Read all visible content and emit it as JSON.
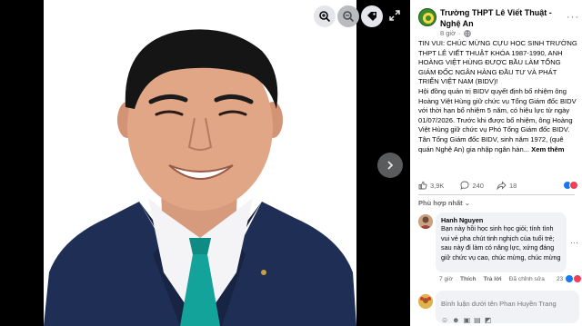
{
  "viewer": {
    "tools": {
      "zoom_in_icon": "zoom-in-icon",
      "zoom_out_icon": "zoom-out-icon",
      "tag_icon": "tag-icon",
      "fullscreen_icon": "expand-icon"
    },
    "next_icon": "chevron-right-icon"
  },
  "post": {
    "page_name": "Trường THPT Lê Viết Thuật - Nghệ An",
    "time": "8 giờ",
    "paragraphs": [
      "TIN VUI: CHÚC MỪNG CỰU HỌC SINH TRƯỜNG THPT LÊ VIẾT THUẬT KHÓA 1987-1990, ANH HOÀNG VIỆT HÙNG ĐƯỢC BẦU LÀM TỔNG GIÁM ĐỐC NGÂN HÀNG ĐẦU TƯ VÀ PHÁT TRIỂN VIỆT NAM (BIDV)!",
      "Hội đồng quản trị BIDV quyết định bổ nhiệm ông Hoàng Việt Hùng giữ chức vụ Tổng Giám đốc BIDV với thời hạn bổ nhiệm 5 năm, có hiệu lực từ ngày 01/07/2026. Trước khi được bổ nhiệm, ông Hoàng Việt Hùng giữ chức vụ Phó Tổng Giám đốc BIDV.",
      "Tân Tổng Giám đốc BIDV, sinh năm 1972, (quê quán Nghệ An) gia nhập ngân hàn..."
    ],
    "see_more": "Xem thêm",
    "stats": {
      "likes": "3,9K",
      "comments": "240",
      "shares": "18"
    }
  },
  "comments": {
    "filter_label": "Phù hợp nhất",
    "items": [
      {
        "author": "Hanh Nguyen",
        "text": "Bạn này hồi học sinh học giỏi; tính tình vui vẻ pha chút tinh nghịch của tuổi trẻ; sau này đi làm có năng lực, xứng đáng giữ chức vụ cao, chúc mừng, chúc mừng",
        "time": "7 giờ",
        "like_label": "Thích",
        "reply_label": "Trả lời",
        "edited_label": "Đã chỉnh sửa",
        "react_count": "23"
      }
    ]
  },
  "composer": {
    "placeholder": "Bình luận dưới tên Phan Huyền Trang"
  },
  "colors": {
    "like_blue": "#1877f2",
    "love_red": "#f33e58",
    "suit_navy": "#1f2e55",
    "tie_teal": "#13a39a"
  }
}
